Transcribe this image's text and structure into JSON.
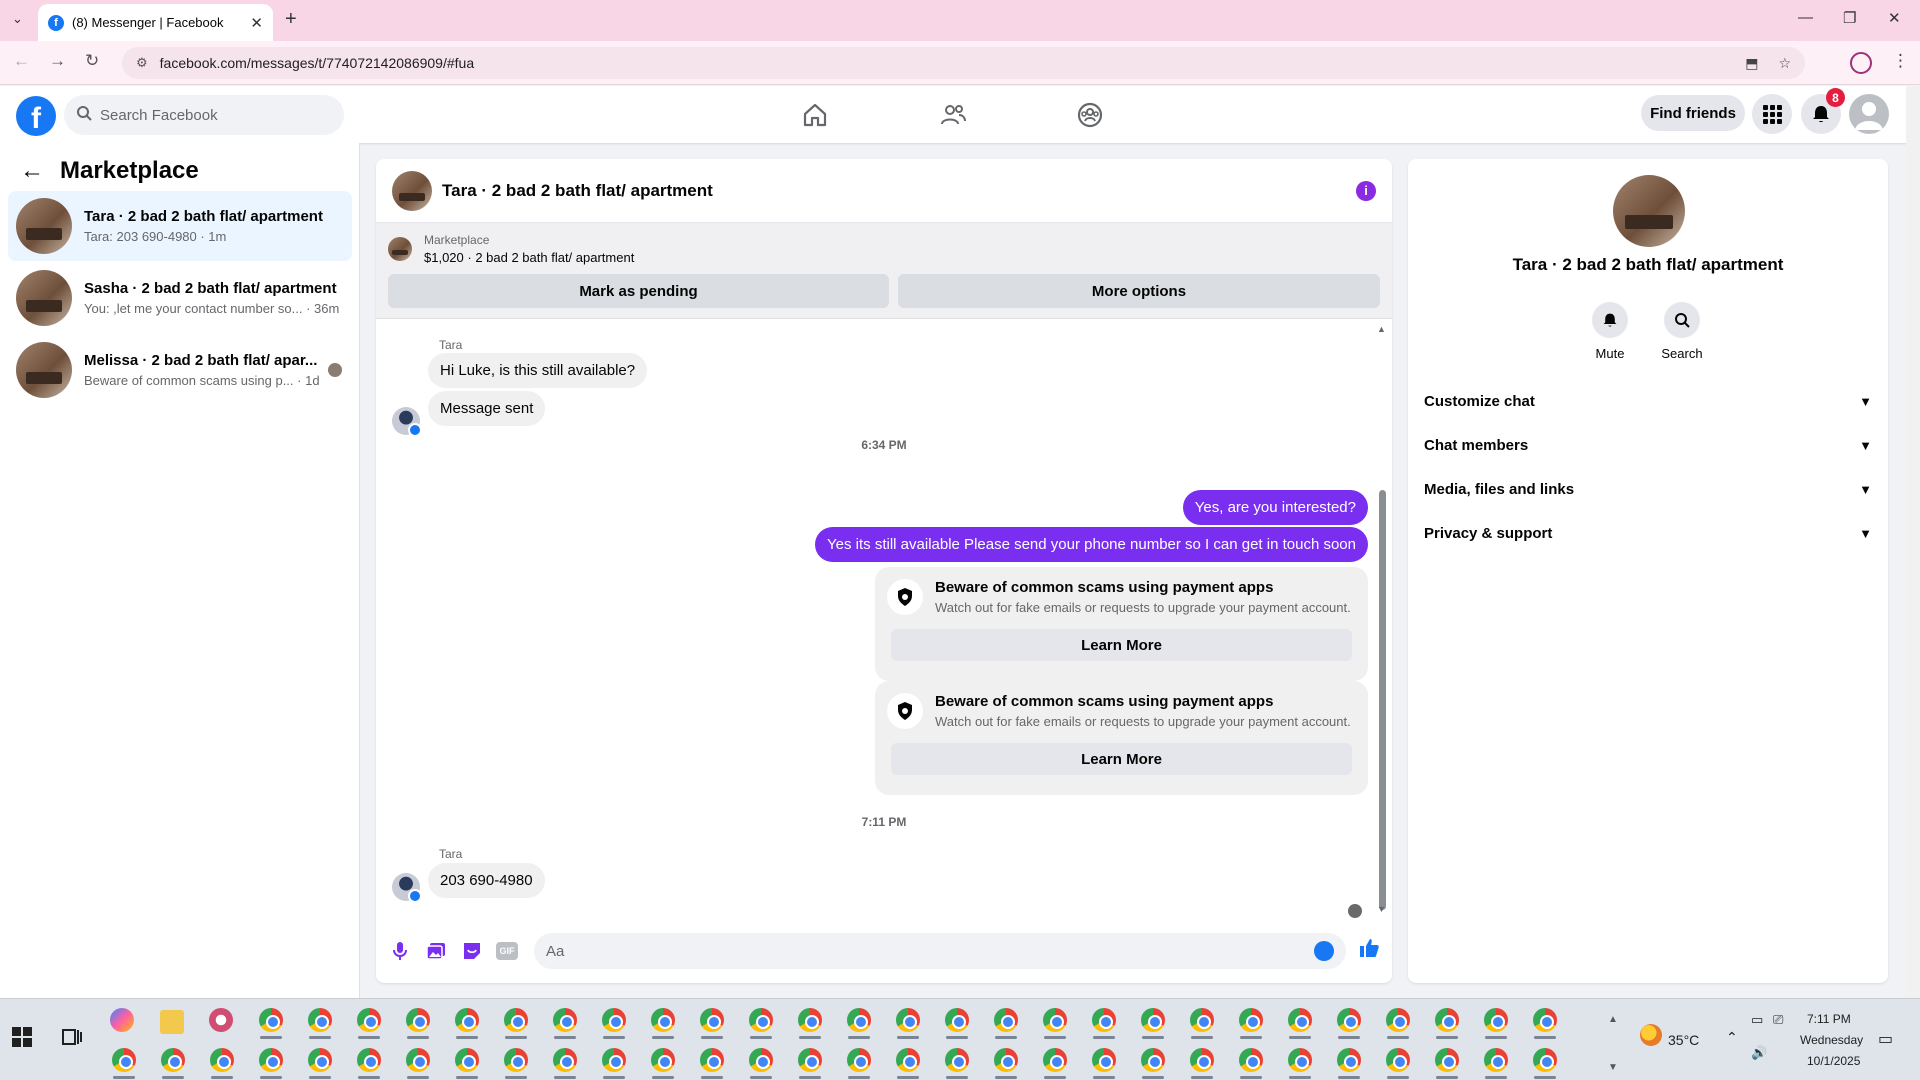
{
  "browser": {
    "tab_title": "(8) Messenger | Facebook",
    "url": "facebook.com/messages/t/774072142086909/#fua"
  },
  "topbar": {
    "search_placeholder": "Search Facebook",
    "find_friends": "Find friends",
    "notification_count": "8"
  },
  "left": {
    "header": "Marketplace",
    "conversations": [
      {
        "title": "Tara · 2 bad 2 bath flat/ apartment",
        "preview": "Tara: 203 690-4980 · 1m",
        "active": true
      },
      {
        "title": "Sasha · 2 bad 2 bath flat/ apartment",
        "preview": "You: ,let me your contact number so... · 36m",
        "active": false
      },
      {
        "title": "Melissa · 2 bad 2 bath flat/ apar...",
        "preview": "Beware of common scams using p... · 1d",
        "active": false
      }
    ]
  },
  "chat": {
    "title": "Tara · 2 bad 2 bath flat/ apartment",
    "marketplace_label": "Marketplace",
    "listing": "$1,020 · 2 bad 2 bath flat/ apartment",
    "mark_pending": "Mark as pending",
    "more_options": "More options",
    "sender1": "Tara",
    "msg_in1": "Hi Luke, is this still available?",
    "msg_in2": "Message sent",
    "time1": "6:34 PM",
    "msg_out1": "Yes, are you interested?",
    "msg_out2": "Yes its still available Please send your phone number so I can get in touch soon",
    "scam_title": "Beware of common scams using payment apps",
    "scam_desc": "Watch out for fake emails or requests to upgrade your payment account.",
    "learn_more": "Learn More",
    "time2": "7:11 PM",
    "sender2": "Tara",
    "msg_in3": "203 690-4980",
    "composer_placeholder": "Aa"
  },
  "right": {
    "title": "Tara · 2 bad 2 bath flat/ apartment",
    "mute": "Mute",
    "search": "Search",
    "rows": [
      "Customize chat",
      "Chat members",
      "Media, files and links",
      "Privacy & support"
    ]
  },
  "taskbar": {
    "temperature": "35°C",
    "time": "7:11 PM",
    "day": "Wednesday",
    "date": "10/1/2025"
  },
  "colors": {
    "accent_purple": "#7a2ff0",
    "facebook_blue": "#1877f2"
  }
}
